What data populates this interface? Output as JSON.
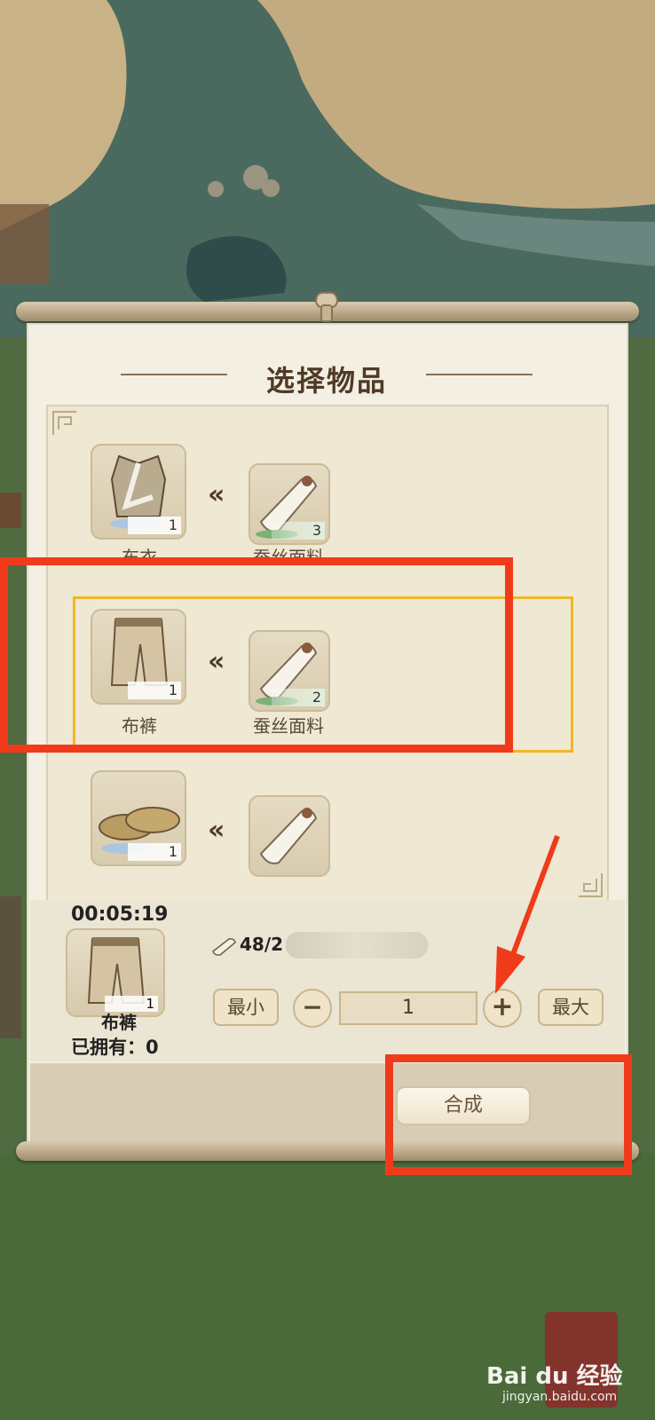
{
  "panel": {
    "title": "选择物品",
    "rows": [
      {
        "product": {
          "name": "布衣",
          "count": "1"
        },
        "material": {
          "name": "蚕丝面料",
          "count": "3"
        }
      },
      {
        "product": {
          "name": "布裤",
          "count": "1"
        },
        "material": {
          "name": "蚕丝面料",
          "count": "2"
        },
        "selected": true
      },
      {
        "product": {
          "name": "",
          "count": "1"
        },
        "material": {
          "name": "",
          "count": ""
        }
      }
    ]
  },
  "detail": {
    "timer": "00:05:19",
    "item_name": "布裤",
    "item_count": "1",
    "owned_label": "已拥有：0",
    "material_amount": "48/2",
    "min_label": "最小",
    "max_label": "最大",
    "quantity": "1",
    "minus_symbol": "−",
    "plus_symbol": "+",
    "compose_label": "合成"
  },
  "watermark": {
    "brand": "Bai du 经验",
    "url": "jingyan.baidu.com"
  },
  "colors": {
    "highlight": "#f03b1b",
    "selection": "#f0b624",
    "panel": "#f3efe2"
  }
}
